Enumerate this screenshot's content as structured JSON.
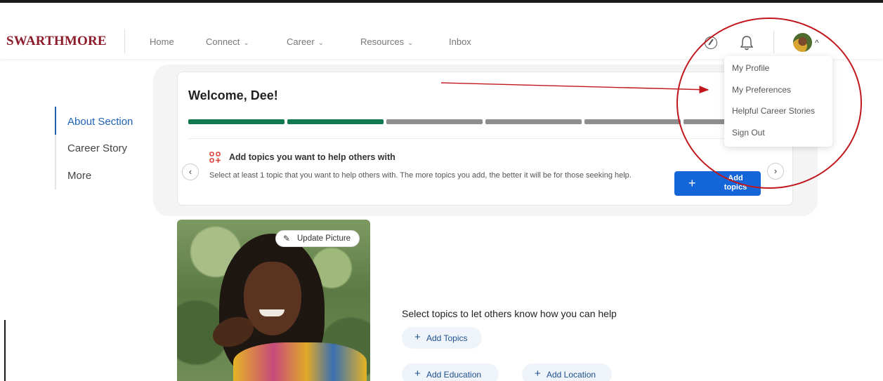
{
  "header": {
    "brand": "SWARTHMORE",
    "nav": [
      {
        "label": "Home",
        "has_menu": false
      },
      {
        "label": "Connect",
        "has_menu": true
      },
      {
        "label": "Career",
        "has_menu": true
      },
      {
        "label": "Resources",
        "has_menu": true
      },
      {
        "label": "Inbox",
        "has_menu": false
      }
    ],
    "icons": [
      "compass-icon",
      "bell-icon",
      "avatar",
      "chevron-up-icon"
    ]
  },
  "profile_menu": {
    "items": [
      "My Profile",
      "My Preferences",
      "Helpful Career Stories",
      "Sign Out"
    ]
  },
  "sidebar": {
    "items": [
      "About Section",
      "Career Story",
      "More"
    ],
    "active": "About Section"
  },
  "welcome_card": {
    "title": "Welcome, Dee!",
    "progress": {
      "completed_steps": 2,
      "total_steps": 6
    },
    "step": {
      "title": "Add topics you want to help others with",
      "description": "Select at least 1 topic that you want to help others with. The more topics you add, the better it will be for those seeking help.",
      "button_label": "Add topics",
      "button_icon": "+"
    },
    "prev_icon": "‹",
    "next_icon": "›"
  },
  "profile": {
    "update_picture_label": "Update Picture",
    "select_topics_title": "Select topics to let others know how you can help",
    "chips": [
      "Add Topics",
      "Add Education",
      "Add Location"
    ],
    "chip_icon": "+"
  },
  "colors": {
    "brand": "#8c1c2b",
    "accent": "#1466d8",
    "progress_done": "#0f7a4f",
    "progress_todo": "#8e8e8e",
    "annotation": "#c0161c"
  }
}
